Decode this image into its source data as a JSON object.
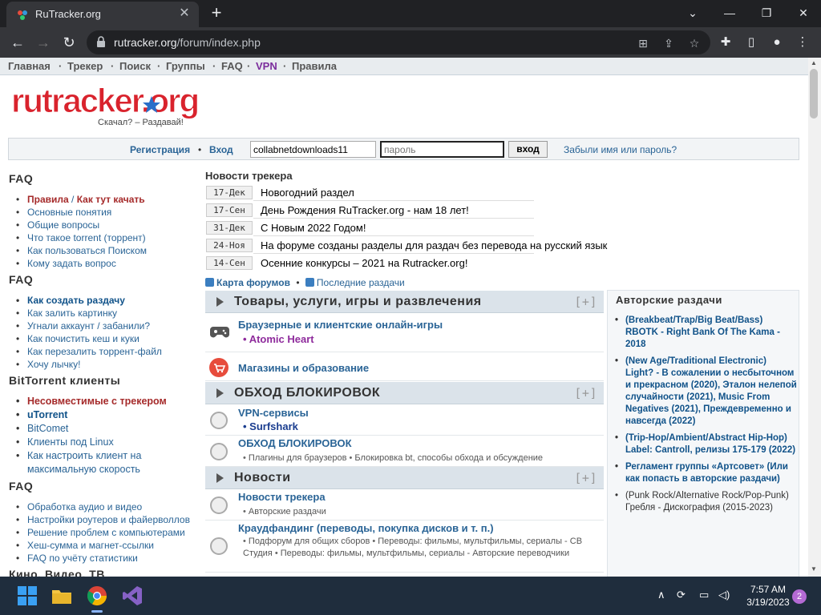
{
  "browser": {
    "tab_title": "RuTracker.org",
    "close_tab": "✕",
    "new_tab": "+",
    "url_domain": "rutracker.org",
    "url_path": "/forum/index.php"
  },
  "topnav": {
    "items": [
      "Главная",
      "Трекер",
      "Поиск",
      "Группы",
      "FAQ",
      "VPN",
      "Правила"
    ],
    "sep": "·"
  },
  "logo": {
    "text": "rutracker.org",
    "slogan": "Скачал? – Раздавай!"
  },
  "login": {
    "register": "Регистрация",
    "login_link": "Вход",
    "username_value": "collabnetdownloads11",
    "password_placeholder": "пароль",
    "submit": "вход",
    "forgot": "Забыли имя или пароль?"
  },
  "sidebar": {
    "sections": [
      {
        "title": "FAQ",
        "items": [
          "Основные понятия",
          "Общие вопросы",
          "Что такое torrent (торрент)",
          "Как пользоваться Поиском",
          "Кому задать вопрос"
        ],
        "first_a": "Правила",
        "first_b": "Как тут качать"
      },
      {
        "title": "FAQ",
        "items": [
          "Как создать раздачу",
          "Как залить картинку",
          "Угнали аккаунт / забанили?",
          "Как почистить кеш и куки",
          "Как перезалить торрент-файл",
          "Хочу лычку!"
        ]
      },
      {
        "title": "BitTorrent клиенты",
        "items": [
          "Несовместимые с трекером",
          "uTorrent",
          "BitComet",
          "Клиенты под Linux",
          "Как настроить клиент на",
          "максимальную скорость"
        ]
      },
      {
        "title": "FAQ",
        "items": [
          "Обработка аудио и видео",
          "Настройки роутеров и файерволлов",
          "Решение проблем с компьютерами",
          "Хеш-сумма и магнет-ссылки",
          "FAQ по учёту статистики"
        ]
      },
      {
        "title": "Кино, Видео, ТВ"
      }
    ]
  },
  "news": {
    "title": "Новости трекера",
    "rows": [
      {
        "date": "17-Дек",
        "text": "Новогодний раздел"
      },
      {
        "date": "17-Сен",
        "text": "День Рождения RuTracker.org - нам 18 лет!"
      },
      {
        "date": "31-Дек",
        "text": "С Новым 2022 Годом!"
      },
      {
        "date": "24-Ноя",
        "text": "На форуме созданы разделы для раздач без перевода на русский язык"
      },
      {
        "date": "14-Сен",
        "text": "Осенние конкурсы – 2021 на Rutracker.org!"
      }
    ],
    "map_link": "Карта форумов",
    "recent_link": "Последние раздачи",
    "dot": "•"
  },
  "categories": [
    {
      "name": "Товары, услуги, игры и развлечения",
      "plus": "[+]"
    },
    {
      "name": "ОБХОД БЛОКИРОВОК",
      "plus": "[+]"
    },
    {
      "name": "Новости",
      "plus": "[+]"
    }
  ],
  "forums": {
    "games": {
      "title": "Браузерные и клиентские онлайн-игры",
      "sub": "Atomic Heart"
    },
    "shops": {
      "title": "Магазины и образование"
    },
    "vpn": {
      "title": "VPN-сервисы",
      "sub": "Surfshark"
    },
    "bypass": {
      "title": "ОБХОД БЛОКИРОВОК",
      "sub1": "Плагины для браузеров",
      "sub2": "Блокировка bt, способы обхода и обсуждение"
    },
    "tracker_news": {
      "title": "Новости трекера",
      "sub": "Авторские раздачи"
    },
    "crowd": {
      "title": "Краудфандинг (переводы, покупка дисков и т. п.)",
      "sub1": "Подфорум для общих сборов",
      "sub2": "Переводы: фильмы, мультфильмы, сериалы - СВ Студия",
      "sub3": "Переводы: фильмы, мультфильмы, сериалы - Авторские переводчики"
    }
  },
  "right": {
    "title": "Авторские раздачи",
    "items": [
      "(Breakbeat/Trap/Big Beat/Bass) RBOTK - Right Bank Of The Kama - 2018",
      "(New Age/Traditional Electronic) Light? - В сожалении о несбыточном и прекрасном (2020), Эталон нелепой случайности (2021), Music From Negatives (2021), Преждевременно и навсегда (2022)",
      "(Trip-Hop/Ambient/Abstract Hip-Hop) Label: Cantroll, релизы 175-179 (2022)",
      "Регламент группы «Артсовет» (Или как попасть в авторские раздачи)",
      "(Punk Rock/Alternative Rock/Pop-Punk) Гребля - Дискография (2015-2023)"
    ]
  },
  "taskbar": {
    "time": "7:57 AM",
    "date": "3/19/2023",
    "notif": "2"
  }
}
